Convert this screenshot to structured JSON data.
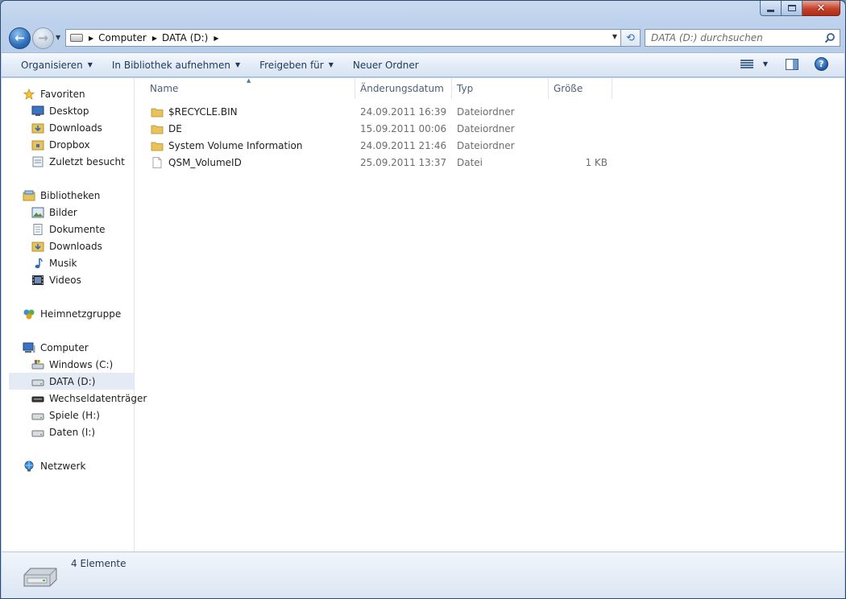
{
  "window": {
    "caption": {
      "minimize": "minimize",
      "maximize": "maximize",
      "close": "close"
    }
  },
  "address": {
    "crumbs": [
      "Computer",
      "DATA (D:)"
    ]
  },
  "search": {
    "placeholder": "DATA (D:) durchsuchen"
  },
  "toolbar": {
    "organize": "Organisieren",
    "include_library": "In Bibliothek aufnehmen",
    "share": "Freigeben für",
    "new_folder": "Neuer Ordner"
  },
  "nav": {
    "favorites": {
      "title": "Favoriten",
      "items": [
        "Desktop",
        "Downloads",
        "Dropbox",
        "Zuletzt besucht"
      ]
    },
    "libraries": {
      "title": "Bibliotheken",
      "items": [
        "Bilder",
        "Dokumente",
        "Downloads",
        "Musik",
        "Videos"
      ]
    },
    "homegroup": {
      "title": "Heimnetzgruppe"
    },
    "computer": {
      "title": "Computer",
      "items": [
        "Windows (C:)",
        "DATA (D:)",
        "Wechseldatenträger",
        "Spiele (H:)",
        "Daten (I:)"
      ],
      "selected": "DATA (D:)"
    },
    "network": {
      "title": "Netzwerk"
    }
  },
  "columns": {
    "name": "Name",
    "date": "Änderungsdatum",
    "type": "Typ",
    "size": "Größe"
  },
  "files": [
    {
      "name": "$RECYCLE.BIN",
      "date": "24.09.2011 16:39",
      "type": "Dateiordner",
      "size": "",
      "icon": "folder-icon"
    },
    {
      "name": "DE",
      "date": "15.09.2011 00:06",
      "type": "Dateiordner",
      "size": "",
      "icon": "folder-icon"
    },
    {
      "name": "System Volume Information",
      "date": "24.09.2011 21:46",
      "type": "Dateiordner",
      "size": "",
      "icon": "folder-icon"
    },
    {
      "name": "QSM_VolumeID",
      "date": "25.09.2011 13:37",
      "type": "Datei",
      "size": "1 KB",
      "icon": "file-icon"
    }
  ],
  "status": {
    "count": "4 Elemente"
  },
  "colors": {
    "accent": "#1e395b",
    "selection": "#e4ebf5",
    "folder": "#e8c25a"
  }
}
